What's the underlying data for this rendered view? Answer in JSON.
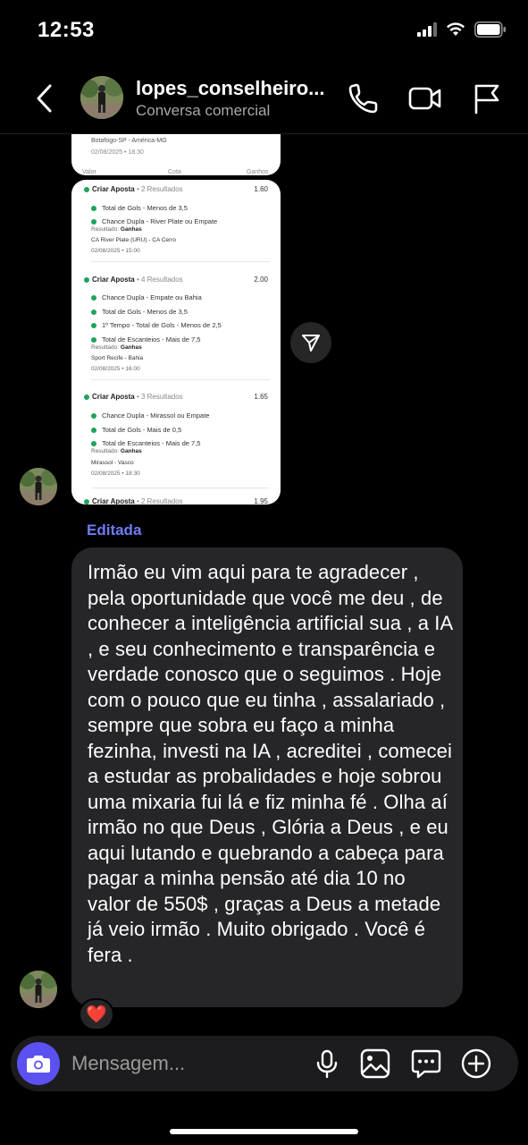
{
  "status": {
    "time": "12:53"
  },
  "header": {
    "username": "lopes_conselheiro...",
    "subtitle": "Conversa comercial"
  },
  "card1": {
    "match": "Botafogo-SP - América-MG",
    "date": "02/08/2025 • 18:30",
    "col_valor": "Valor",
    "col_cota": "Cota",
    "col_ganhos": "Ganhos"
  },
  "bets": [
    {
      "title": "Criar Aposta",
      "count": "• 2 Resultados",
      "odd": "1.60",
      "selections": [
        "Total de Gols - Menos de 3,5",
        "Chance Dupla - River Plate ou Empate"
      ],
      "result_label": "Resultado:",
      "result_value": "Ganhas",
      "match": "CA River Plate (URU) - CA Cerro",
      "date": "02/08/2025 • 15:00"
    },
    {
      "title": "Criar Aposta",
      "count": "• 4 Resultados",
      "odd": "2.00",
      "selections": [
        "Chance Dupla - Empate ou Bahia",
        "Total de Gols - Menos de 3,5",
        "1º Tempo - Total de Gols - Menos de 2,5",
        "Total de Escanteios - Mais de 7,5"
      ],
      "result_label": "Resultado:",
      "result_value": "Ganhas",
      "match": "Sport Recife - Bahia",
      "date": "02/08/2025 • 16:00"
    },
    {
      "title": "Criar Aposta",
      "count": "• 3 Resultados",
      "odd": "1.65",
      "selections": [
        "Chance Dupla - Mirassol ou Empate",
        "Total de Gols - Mais de 0,5",
        "Total de Escanteios - Mais de 7,5"
      ],
      "result_label": "Resultado:",
      "result_value": "Ganhas",
      "match": "Mirassol - Vasco",
      "date": "02/08/2025 • 18:30"
    },
    {
      "title": "Criar Aposta",
      "count": "• 2 Resultados",
      "odd": "1.95"
    }
  ],
  "message": {
    "edited_label": "Editada",
    "text": "Irmão eu vim aqui para te agradecer , pela oportunidade que você me deu , de conhecer a inteligência artificial sua , a IA , e seu conhecimento e transparência e verdade conosco que o seguimos . Hoje com o pouco que eu tinha , assalariado , sempre que sobra eu faço a minha fezinha, investi na IA , acreditei , comecei a estudar as probalidades e hoje sobrou uma mixaria fui lá e fiz minha fé . Olha aí irmão no que Deus , Glória a Deus , e eu aqui lutando e quebrando a cabeça para pagar a minha pensão até dia 10 no valor de 550$ , graças a Deus a metade já veio irmão . Muito obrigado . Você é fera .",
    "reaction": "❤️"
  },
  "composer": {
    "placeholder": "Mensagem..."
  }
}
